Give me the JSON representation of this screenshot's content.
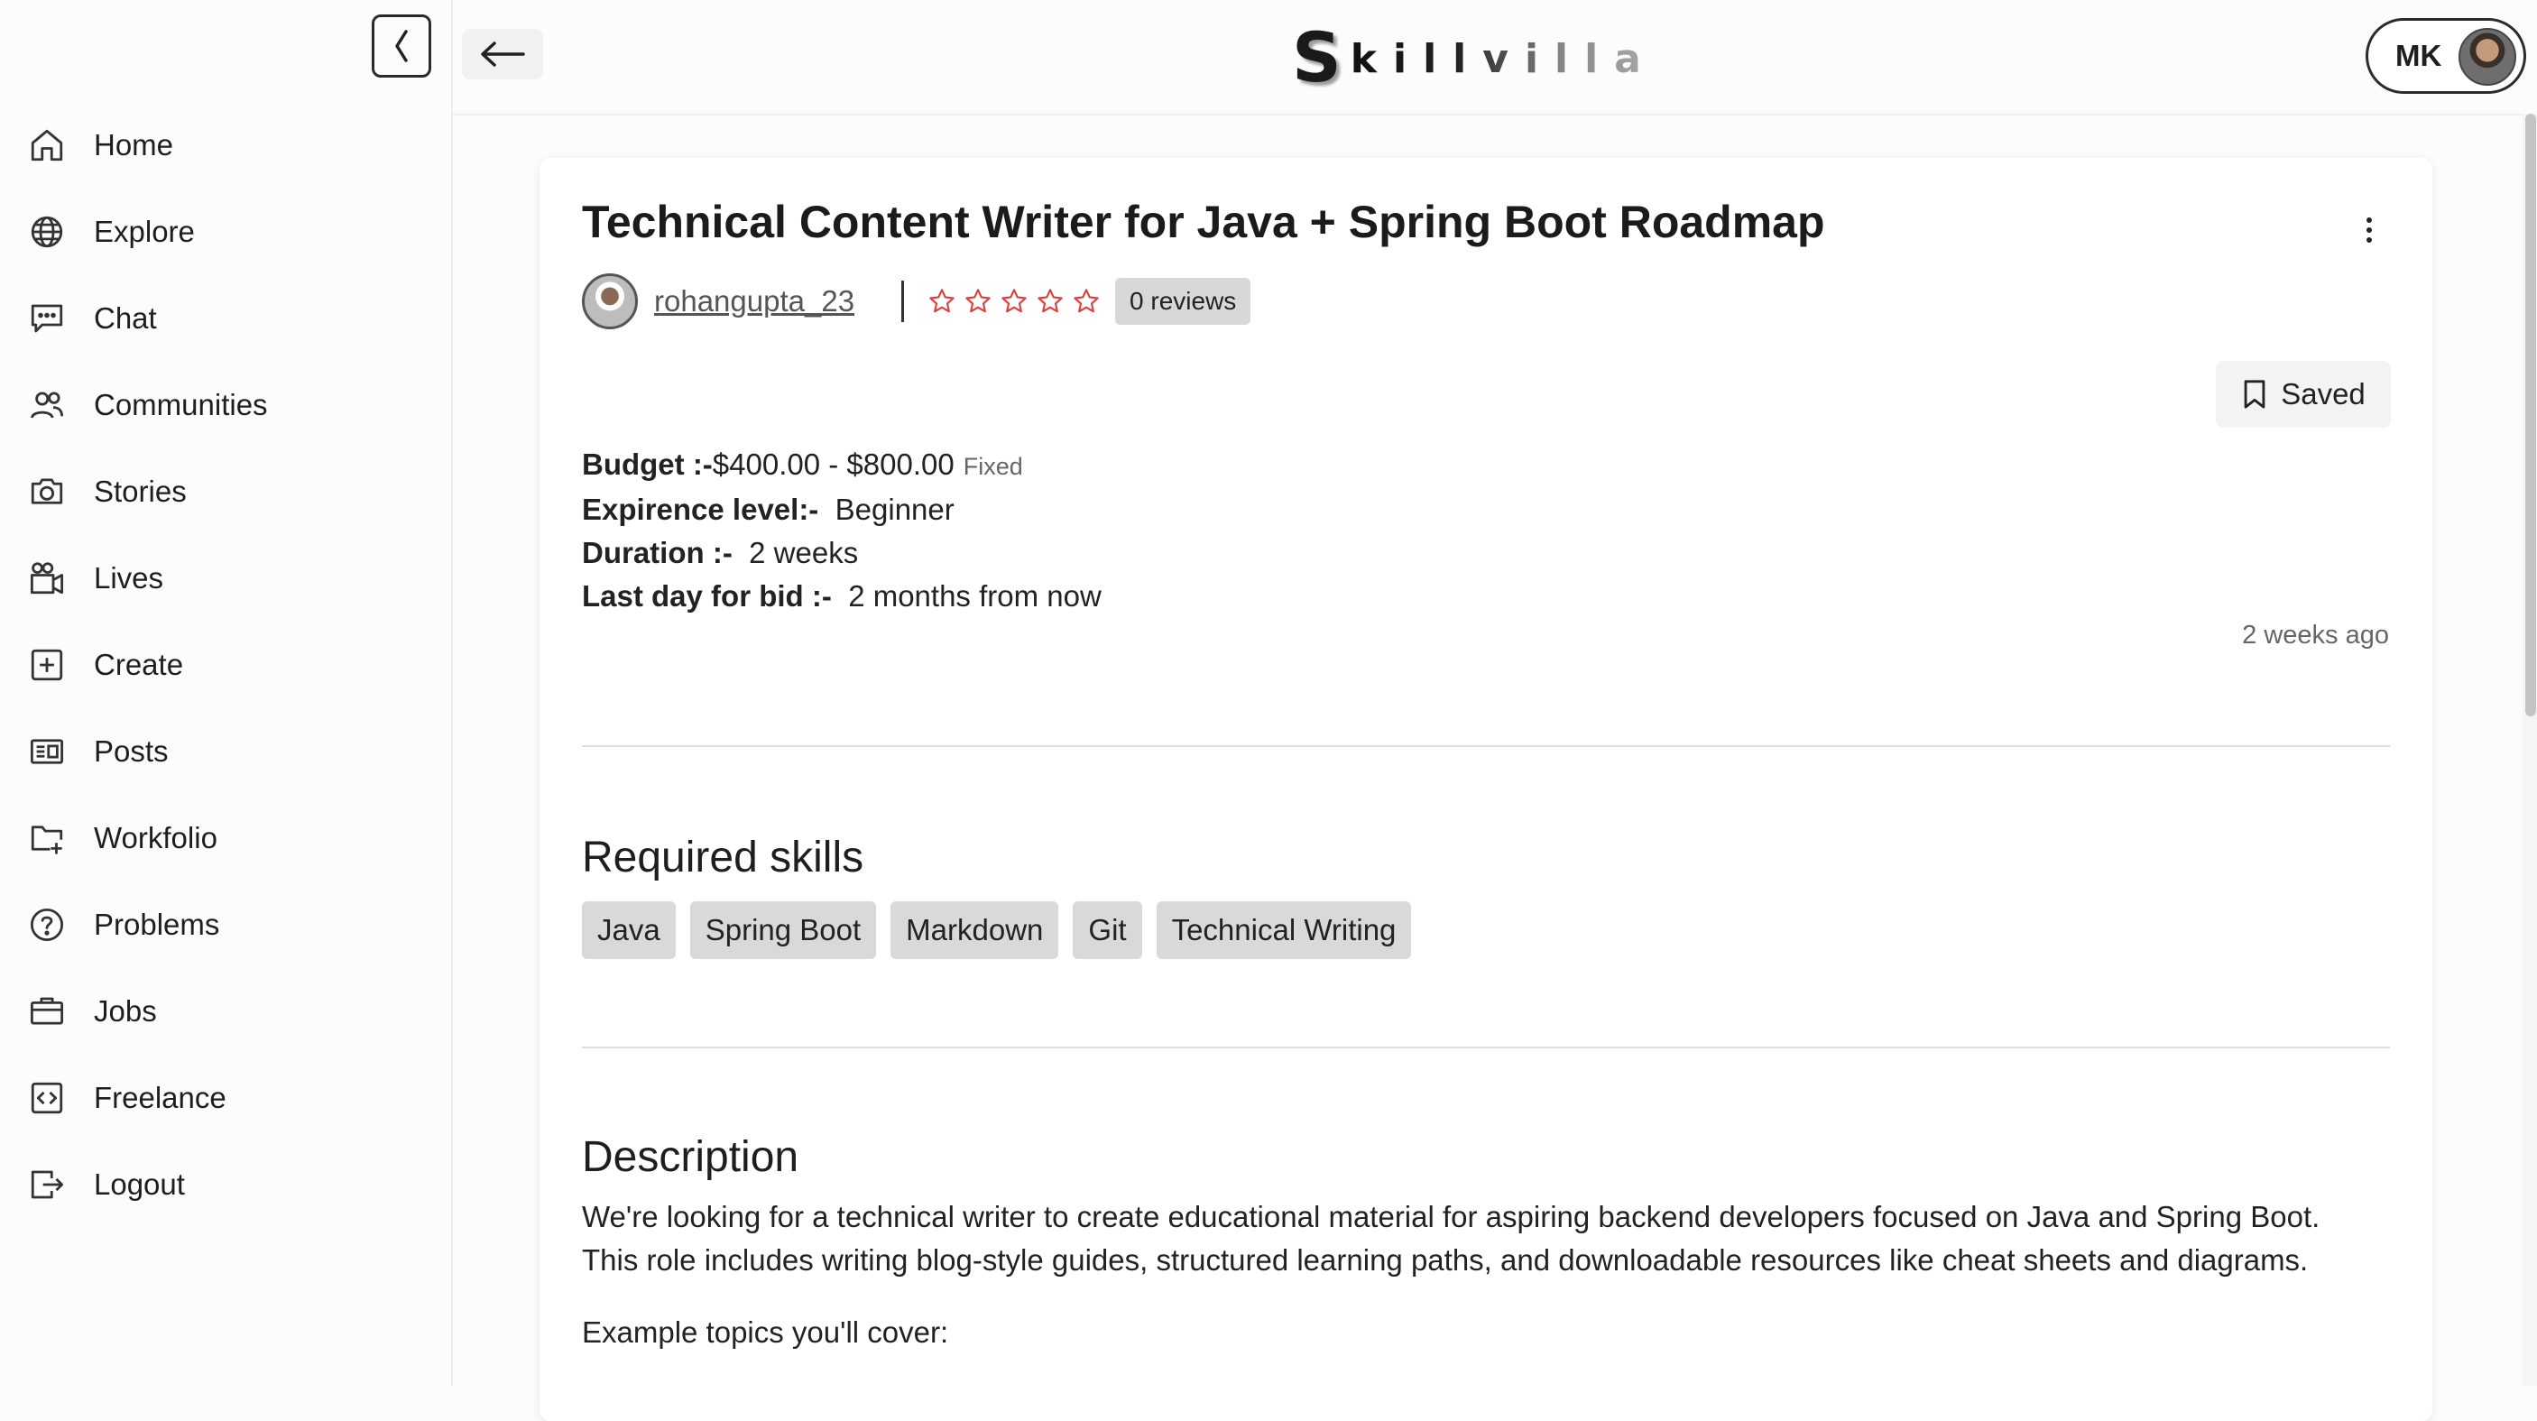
{
  "sidebar": {
    "items": [
      {
        "label": "Home",
        "icon": "home-icon"
      },
      {
        "label": "Explore",
        "icon": "globe-icon"
      },
      {
        "label": "Chat",
        "icon": "chat-icon"
      },
      {
        "label": "Communities",
        "icon": "users-icon"
      },
      {
        "label": "Stories",
        "icon": "camera-icon"
      },
      {
        "label": "Lives",
        "icon": "video-camera-icon"
      },
      {
        "label": "Create",
        "icon": "plus-square-icon"
      },
      {
        "label": "Posts",
        "icon": "newspaper-icon"
      },
      {
        "label": "Workfolio",
        "icon": "folder-plus-icon"
      },
      {
        "label": "Problems",
        "icon": "question-circle-icon"
      },
      {
        "label": "Jobs",
        "icon": "briefcase-icon"
      },
      {
        "label": "Freelance",
        "icon": "code-square-icon"
      },
      {
        "label": "Logout",
        "icon": "logout-icon"
      }
    ]
  },
  "header": {
    "logo_first": "S",
    "logo_rest": "killvilla",
    "user_initials": "MK"
  },
  "job": {
    "title": "Technical Content Writer for Java + Spring Boot Roadmap",
    "author": "rohangupta_23",
    "rating": 0,
    "reviews": "0 reviews",
    "saved_label": "Saved",
    "budget_label": "Budget :-",
    "budget_value": "$400.00 - $800.00",
    "budget_type": "Fixed",
    "experience_label": "Expirence level:-",
    "experience_value": "Beginner",
    "duration_label": "Duration :-",
    "duration_value": "2 weeks",
    "lastday_label": "Last day for bid :-",
    "lastday_value": "2 months from now",
    "posted": "2 weeks ago",
    "skills_title": "Required skills",
    "skills": [
      "Java",
      "Spring Boot",
      "Markdown",
      "Git",
      "Technical Writing"
    ],
    "description_title": "Description",
    "description_line1": "We're looking for a technical writer to create educational material for aspiring backend developers focused on Java and Spring Boot.",
    "description_line2": "This role includes writing blog-style guides, structured learning paths, and downloadable resources like cheat sheets and diagrams.",
    "description_line3": "Example topics you'll cover:"
  },
  "colors": {
    "star": "#d9423b",
    "chip": "#d9d9d9"
  }
}
